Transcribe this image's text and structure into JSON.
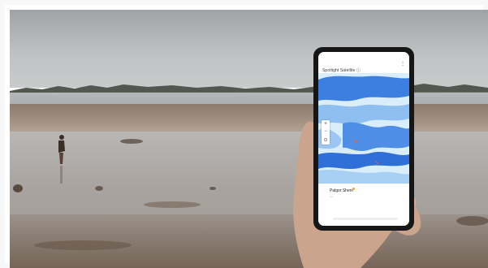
{
  "photo": {
    "subject": "hand-holding-phone-on-tidal-flat"
  },
  "phone_app": {
    "title": "Spotlight Satellite ⓘ",
    "menu_icon": "overflow-icon",
    "zoom_in": "+",
    "zoom_out": "−",
    "location_icon": "locate-icon",
    "place_name": "Palgor Sheni",
    "place_subtitle": "—",
    "bottom_sheet_icon": "pin-icon"
  },
  "colors": {
    "map_water": "#cfe7f7",
    "map_flood": "#2f6fd6",
    "map_mid": "#6fa6e8",
    "accent_marker": "#e06b3c"
  }
}
